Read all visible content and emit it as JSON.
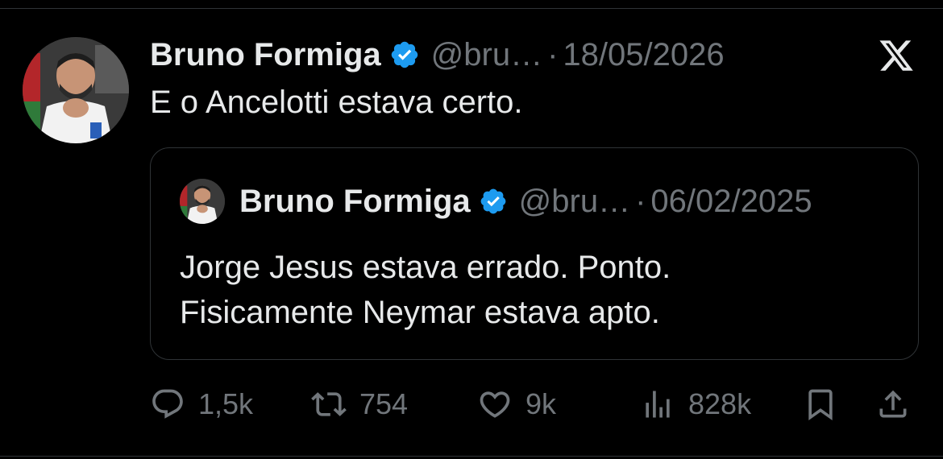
{
  "tweet": {
    "author_name": "Bruno Formiga",
    "handle": "@bru…",
    "separator": "·",
    "date": "18/05/2026",
    "text": "E o Ancelotti estava certo."
  },
  "quote": {
    "author_name": "Bruno Formiga",
    "handle": "@bru…",
    "separator": "·",
    "date": "06/02/2025",
    "lines": [
      "Jorge Jesus estava errado. Ponto.",
      "Fisicamente Neymar estava apto."
    ]
  },
  "actions": {
    "replies": "1,5k",
    "reposts": "754",
    "likes": "9k",
    "views": "828k"
  },
  "icons": {
    "verified": "verified-badge-icon",
    "logo": "x-logo-icon",
    "reply": "reply-icon",
    "repost": "repost-icon",
    "like": "heart-icon",
    "views": "views-icon",
    "bookmark": "bookmark-icon",
    "share": "share-icon"
  },
  "colors": {
    "background": "#000000",
    "text": "#e7e9ea",
    "secondary": "#71767b",
    "verified": "#1d9bf0",
    "border": "#2f3336"
  }
}
